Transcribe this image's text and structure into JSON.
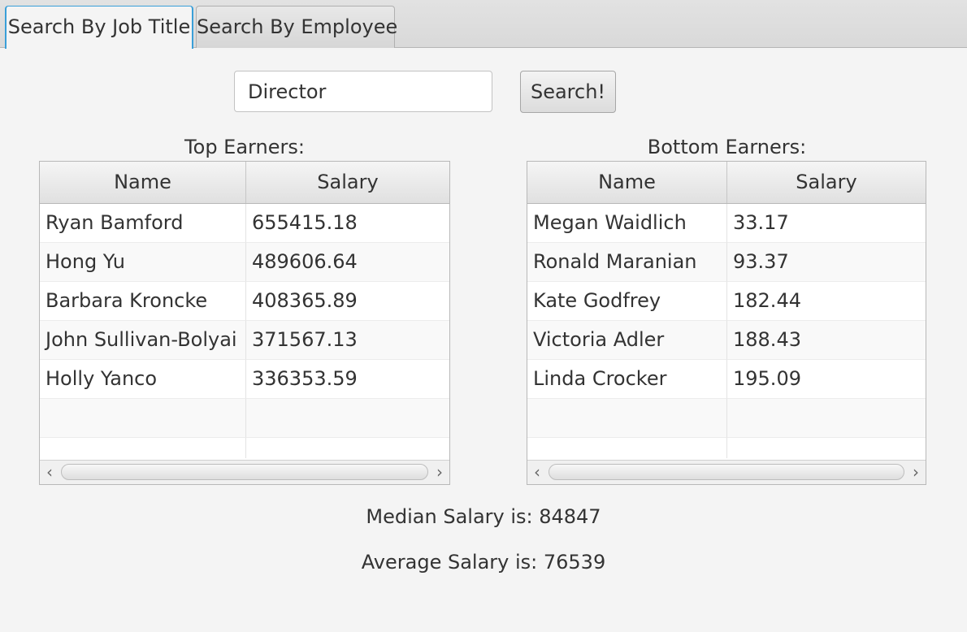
{
  "tabs": [
    {
      "label": "Search By Job Title",
      "active": true
    },
    {
      "label": "Search By Employee",
      "active": false
    }
  ],
  "search": {
    "value": "Director",
    "button_label": "Search!"
  },
  "top_earners": {
    "label": "Top Earners:",
    "columns": [
      "Name",
      "Salary"
    ],
    "rows": [
      [
        "Ryan Bamford",
        "655415.18"
      ],
      [
        "Hong Yu",
        "489606.64"
      ],
      [
        "Barbara Kroncke",
        "408365.89"
      ],
      [
        "John Sullivan-Bolyai",
        "371567.13"
      ],
      [
        "Holly Yanco",
        "336353.59"
      ],
      [
        "",
        ""
      ],
      [
        "",
        ""
      ]
    ]
  },
  "bottom_earners": {
    "label": "Bottom Earners:",
    "columns": [
      "Name",
      "Salary"
    ],
    "rows": [
      [
        "Megan Waidlich",
        "33.17"
      ],
      [
        "Ronald Maranian",
        "93.37"
      ],
      [
        "Kate Godfrey",
        "182.44"
      ],
      [
        "Victoria Adler",
        "188.43"
      ],
      [
        "Linda Crocker",
        "195.09"
      ],
      [
        "",
        ""
      ],
      [
        "",
        ""
      ]
    ]
  },
  "median_text": "Median Salary is: 84847",
  "average_text": "Average Salary is: 76539",
  "icons": {
    "scroll_left": "‹",
    "scroll_right": "›"
  },
  "colors": {
    "accent": "#3a9fd8"
  }
}
